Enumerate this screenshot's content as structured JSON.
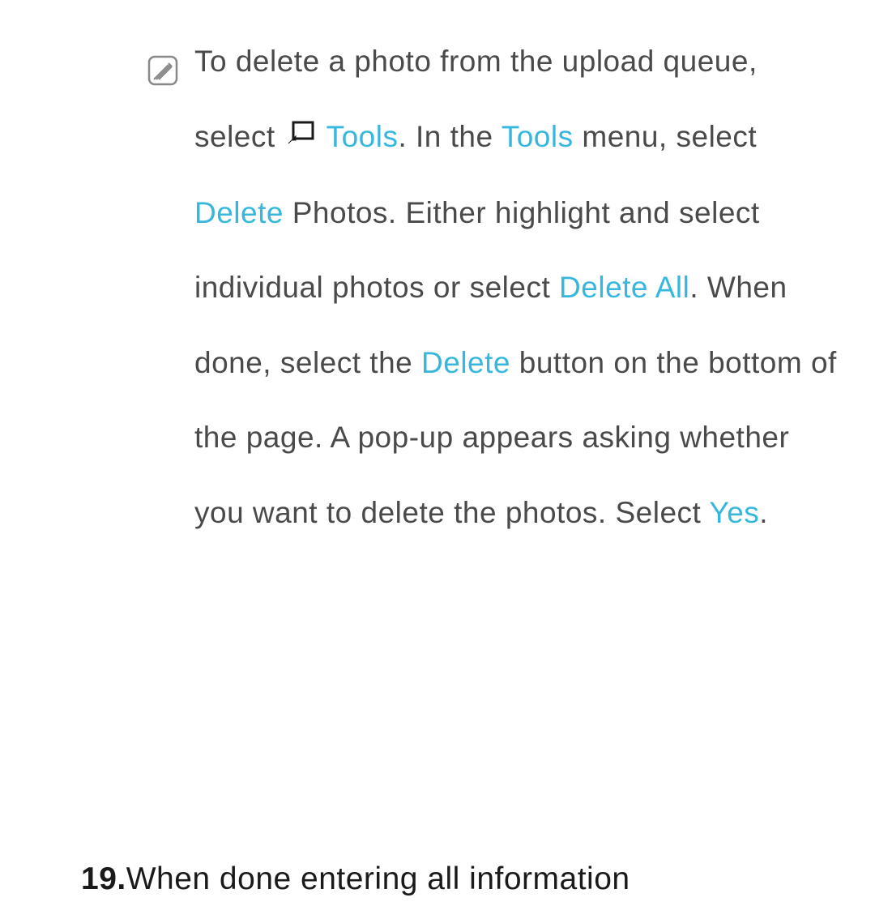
{
  "note": {
    "part1": "To delete a photo from the upload queue, select ",
    "tools1": "Tools",
    "part2": ". In the ",
    "tools2": "Tools",
    "part3": " menu, select ",
    "delete1": "Delete",
    "part4": " Photos. Either highlight and select individual photos or select ",
    "deleteall": "Delete All",
    "part5": ". When done, select the ",
    "delete2": "Delete",
    "part6": " button on the bottom of the page. A pop-up appears asking whether you want to delete the photos. Select ",
    "yes": "Yes",
    "part7": "."
  },
  "step": {
    "number": "19.",
    "text": "When done entering all information"
  }
}
